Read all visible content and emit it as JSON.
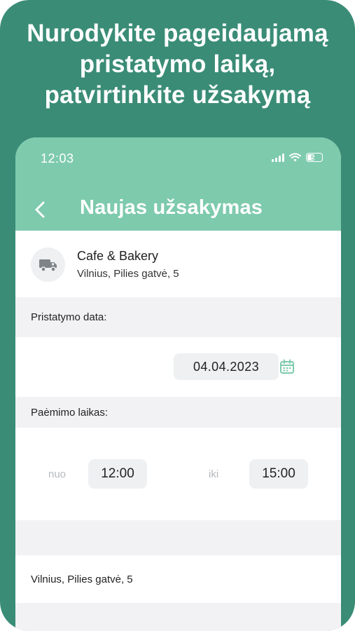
{
  "headline": {
    "line1": "Nurodykite pageidaujamą",
    "line2": "pristatymo laiką,",
    "line3": "patvirtinkite užsakymą"
  },
  "status_bar": {
    "time": "12:03",
    "battery": "56",
    "icons": [
      "signal-icon",
      "wifi-icon",
      "battery-icon"
    ]
  },
  "header": {
    "title": "Naujas užsakymas",
    "back_icon": "chevron-left-icon"
  },
  "store": {
    "name": "Cafe & Bakery",
    "address": "Vilnius, Pilies gatvė, 5",
    "icon": "truck-icon"
  },
  "delivery_date": {
    "label": "Pristatymo data:",
    "value": "04.04.2023",
    "icon": "calendar-icon"
  },
  "pickup_time": {
    "label": "Paėmimo laikas:",
    "from_label": "nuo",
    "from_value": "12:00",
    "to_label": "iki",
    "to_value": "15:00"
  },
  "address": {
    "value": "Vilnius, Pilies gatvė, 5"
  },
  "colors": {
    "frame": "#3a8c76",
    "header": "#7ecaad",
    "accent": "#7ecaad",
    "background": "#f2f2f4"
  }
}
